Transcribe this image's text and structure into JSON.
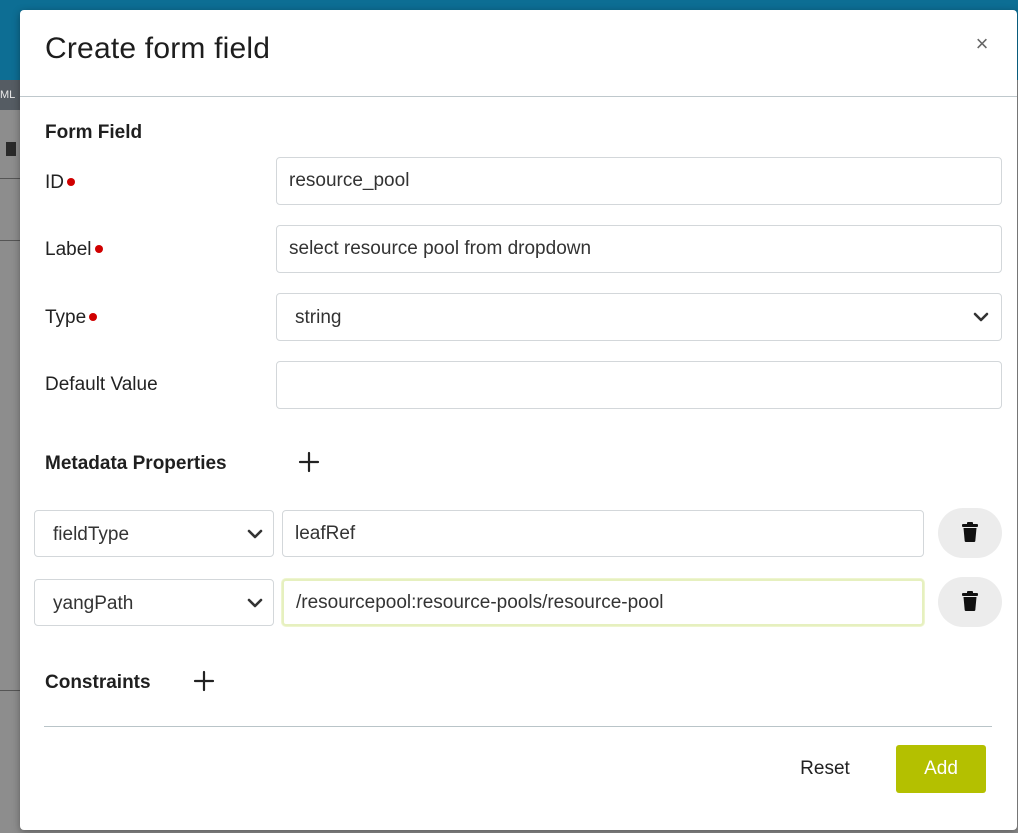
{
  "modal": {
    "title": "Create form field",
    "close_symbol": "×"
  },
  "form_field": {
    "section_title": "Form Field",
    "id": {
      "label": "ID",
      "value": "resource_pool",
      "required": true
    },
    "label": {
      "label": "Label",
      "value": "select resource pool from dropdown",
      "required": true
    },
    "type": {
      "label": "Type",
      "value": "string",
      "required": true
    },
    "default_value": {
      "label": "Default Value",
      "value": ""
    }
  },
  "metadata": {
    "section_title": "Metadata Properties",
    "rows": [
      {
        "key": "fieldType",
        "value": "leafRef"
      },
      {
        "key": "yangPath",
        "value": "/resourcepool:resource-pools/resource-pool"
      }
    ]
  },
  "constraints": {
    "section_title": "Constraints"
  },
  "footer": {
    "reset_label": "Reset",
    "add_label": "Add"
  },
  "colors": {
    "accent": "#b4c000",
    "required_dot": "#d00000",
    "header_bar": "#0d6e94"
  },
  "icons": [
    "close-icon",
    "plus-icon",
    "chevron-down-icon",
    "trash-icon"
  ]
}
